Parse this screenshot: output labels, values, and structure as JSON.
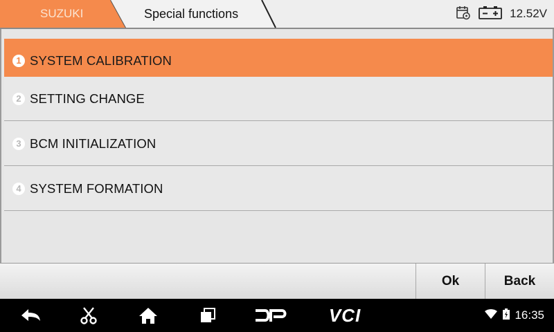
{
  "header": {
    "breadcrumb": [
      "SUZUKI",
      "Special functions"
    ],
    "voltage": "12.52V"
  },
  "menu": {
    "items": [
      {
        "number": "1",
        "label": "SYSTEM CALIBRATION",
        "selected": true
      },
      {
        "number": "2",
        "label": "SETTING CHANGE",
        "selected": false
      },
      {
        "number": "3",
        "label": "BCM INITIALIZATION",
        "selected": false
      },
      {
        "number": "4",
        "label": "SYSTEM FORMATION",
        "selected": false
      }
    ]
  },
  "actions": {
    "ok_label": "Ok",
    "back_label": "Back"
  },
  "navbar": {
    "icons": [
      "back-arrow-icon",
      "scissors-icon",
      "home-icon",
      "recent-apps-icon",
      "dp-icon",
      "vci-icon"
    ],
    "dp_text": "DP",
    "vci_text": "VCI",
    "clock": "16:35"
  },
  "colors": {
    "accent": "#f58a4c",
    "header_bg": "#eeeeee",
    "panel_bg": "#e6e6e6",
    "navbar_bg": "#000000"
  }
}
